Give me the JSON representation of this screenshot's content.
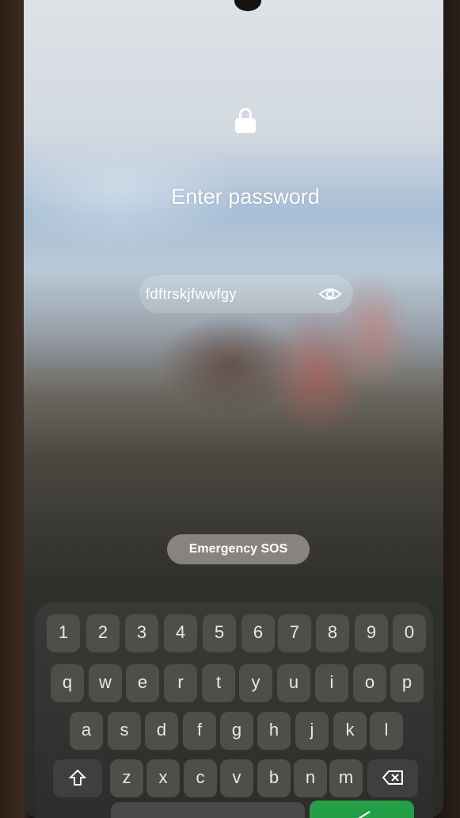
{
  "lock_screen": {
    "title": "Enter password",
    "password_value": "fdftrskjfwwfgy",
    "emergency_label": "Emergency SOS",
    "icons": {
      "lock": "lock-icon",
      "visibility": "eye-icon"
    }
  },
  "keyboard": {
    "number_row": [
      "1",
      "2",
      "3",
      "4",
      "5",
      "6",
      "7",
      "8",
      "9",
      "0"
    ],
    "row1": [
      "q",
      "w",
      "e",
      "r",
      "t",
      "y",
      "u",
      "i",
      "o",
      "p"
    ],
    "row2": [
      "a",
      "s",
      "d",
      "f",
      "g",
      "h",
      "j",
      "k",
      "l"
    ],
    "row3": [
      "z",
      "x",
      "c",
      "v",
      "b",
      "n",
      "m"
    ],
    "shift_icon": "shift-icon",
    "backspace_icon": "backspace-icon",
    "enter_icon": "enter-icon",
    "enter_color": "#23a047"
  }
}
